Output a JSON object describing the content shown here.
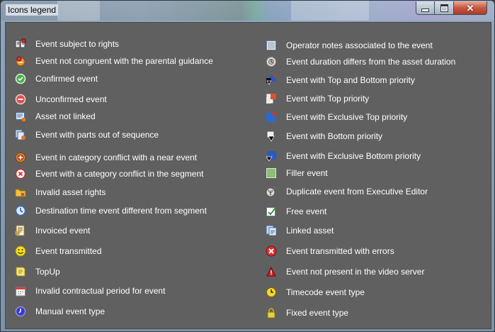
{
  "window": {
    "title": "Icons legend"
  },
  "left": [
    {
      "label": "Event subject to rights",
      "icon": "rights-book-icon"
    },
    {
      "label": "Event not congruent with the parental guidance",
      "icon": "parental-guidance-icon"
    },
    {
      "label": "Confirmed event",
      "icon": "confirmed-icon"
    },
    {
      "label": "Unconfirmed event",
      "icon": "unconfirmed-icon"
    },
    {
      "label": "Asset not linked",
      "icon": "asset-not-linked-icon"
    },
    {
      "label": "Event with parts out of sequence",
      "icon": "parts-out-of-sequence-icon"
    },
    {
      "label": "Event in category conflict with a near event",
      "icon": "category-conflict-near-icon"
    },
    {
      "label": "Event with a category conflict in the segment",
      "icon": "category-conflict-segment-icon"
    },
    {
      "label": "Invalid asset rights",
      "icon": "invalid-asset-rights-icon"
    },
    {
      "label": "Destination time event different from segment",
      "icon": "destination-time-icon"
    },
    {
      "label": "Invoiced event",
      "icon": "invoiced-icon"
    },
    {
      "label": "Event transmitted",
      "icon": "smiley-icon"
    },
    {
      "label": "TopUp",
      "icon": "topup-note-icon"
    },
    {
      "label": "Invalid contractual period for event",
      "icon": "calendar-icon"
    },
    {
      "label": "Manual event type",
      "icon": "manual-clock-icon"
    }
  ],
  "right": [
    {
      "label": "Operator notes associated to the event",
      "icon": "operator-notes-icon"
    },
    {
      "label": "Event duration differs from the asset duration",
      "icon": "duration-differs-icon"
    },
    {
      "label": "Event with Top and Bottom priority",
      "icon": "top-bottom-priority-icon"
    },
    {
      "label": "Event with Top priority",
      "icon": "top-priority-icon"
    },
    {
      "label": "Event with Exclusive Top priority",
      "icon": "exclusive-top-priority-icon"
    },
    {
      "label": "Event with Bottom priority",
      "icon": "bottom-priority-icon"
    },
    {
      "label": "Event with Exclusive Bottom priority",
      "icon": "exclusive-bottom-priority-icon"
    },
    {
      "label": "Filler event",
      "icon": "filler-icon"
    },
    {
      "label": "Duplicate event from Executive Editor",
      "icon": "duplicate-reel-icon"
    },
    {
      "label": "Free event",
      "icon": "free-event-icon"
    },
    {
      "label": "Linked asset",
      "icon": "linked-asset-icon"
    },
    {
      "label": "Event transmitted with errors",
      "icon": "error-icon"
    },
    {
      "label": "Event not present in the video server",
      "icon": "warning-icon"
    },
    {
      "label": "Timecode event type",
      "icon": "timecode-icon"
    },
    {
      "label": "Fixed event type",
      "icon": "lock-icon"
    }
  ]
}
